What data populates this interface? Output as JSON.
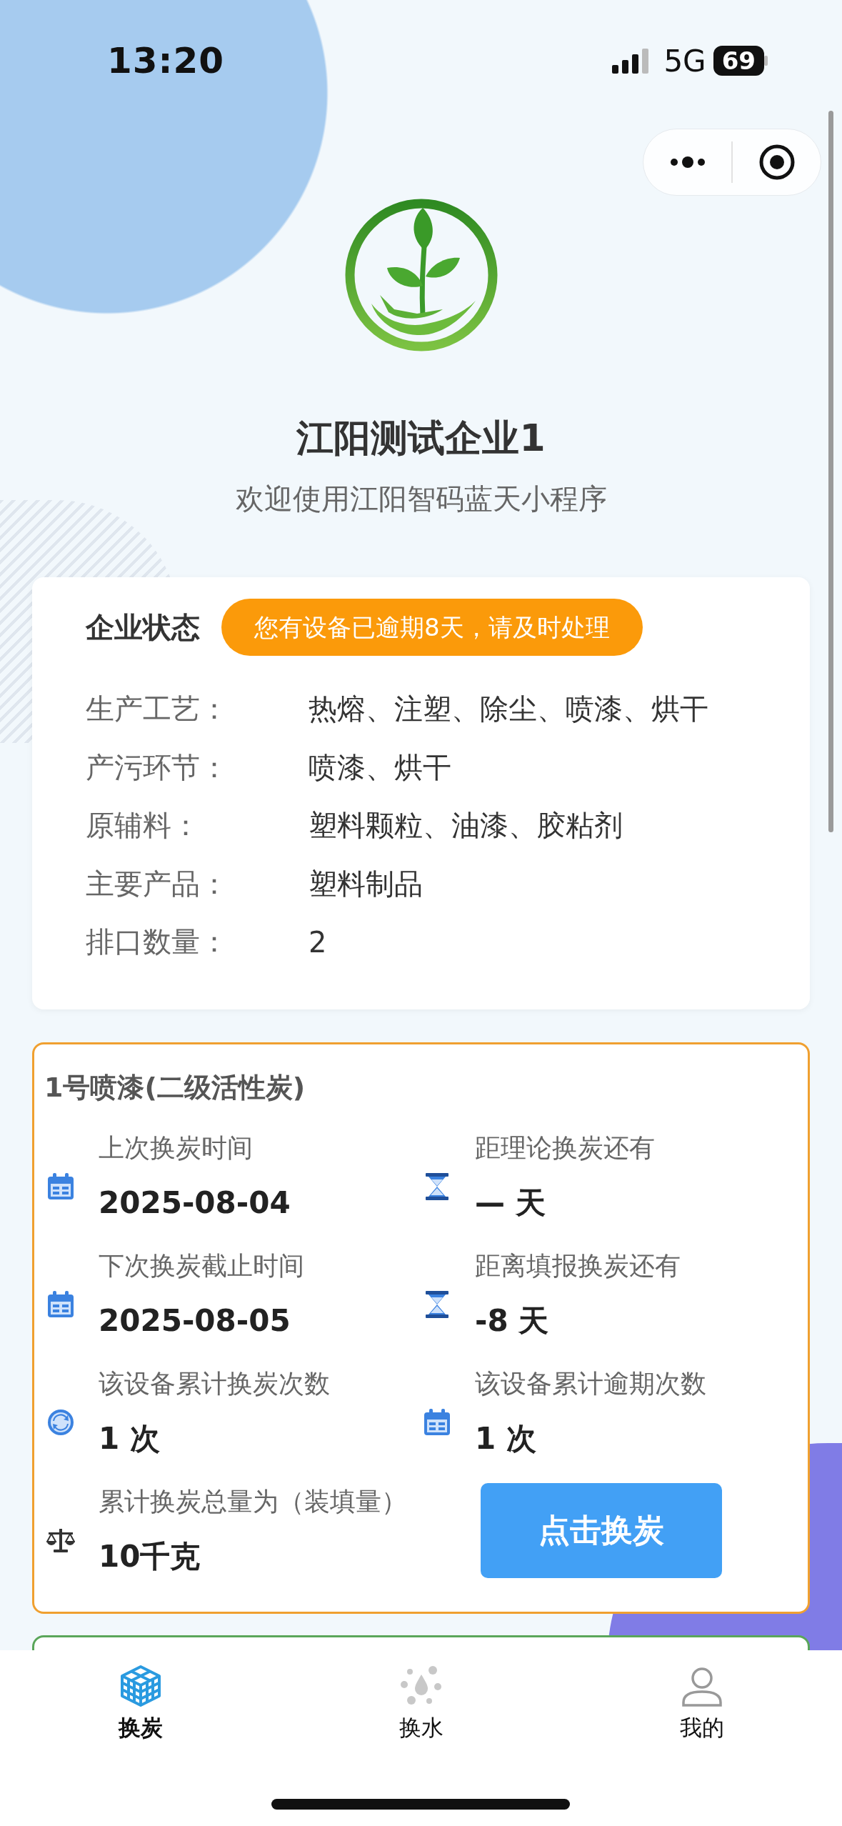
{
  "status_bar": {
    "time": "13:20",
    "network": "5G",
    "battery": "69"
  },
  "company": {
    "name": "江阳测试企业1",
    "welcome": "欢迎使用江阳智码蓝天小程序"
  },
  "status_card": {
    "title": "企业状态",
    "alert": "您有设备已逾期8天，请及时处理",
    "fields": [
      {
        "label": "生产工艺：",
        "value": "热熔、注塑、除尘、喷漆、烘干"
      },
      {
        "label": "产污环节：",
        "value": "喷漆、烘干"
      },
      {
        "label": "原辅料：",
        "value": "塑料颗粒、油漆、胶粘剂"
      },
      {
        "label": "主要产品：",
        "value": "塑料制品"
      },
      {
        "label": "排口数量：",
        "value": "2"
      }
    ]
  },
  "devices": [
    {
      "title": "1号喷漆(二级活性炭)",
      "stats": [
        {
          "kind": "calendar",
          "label": "上次换炭时间",
          "value": "2025-08-04"
        },
        {
          "kind": "hourglass",
          "label": "距理论换炭还有",
          "value": "— 天"
        },
        {
          "kind": "calendar",
          "label": "下次换炭截止时间",
          "value": "2025-08-05"
        },
        {
          "kind": "hourglass",
          "label": "距离填报换炭还有",
          "value": "-8 天"
        },
        {
          "kind": "refresh",
          "label": "该设备累计换炭次数",
          "value": "1 次"
        },
        {
          "kind": "calendar",
          "label": "该设备累计逾期次数",
          "value": "1 次"
        },
        {
          "kind": "scale",
          "label": "累计换炭总量为（装填量）",
          "value": "10千克"
        }
      ],
      "button": "点击换炭"
    }
  ],
  "tabs": [
    {
      "label": "换炭",
      "kind": "cube",
      "selected": true
    },
    {
      "label": "换水",
      "kind": "drops",
      "selected": false
    },
    {
      "label": "我的",
      "kind": "person",
      "selected": false
    }
  ]
}
